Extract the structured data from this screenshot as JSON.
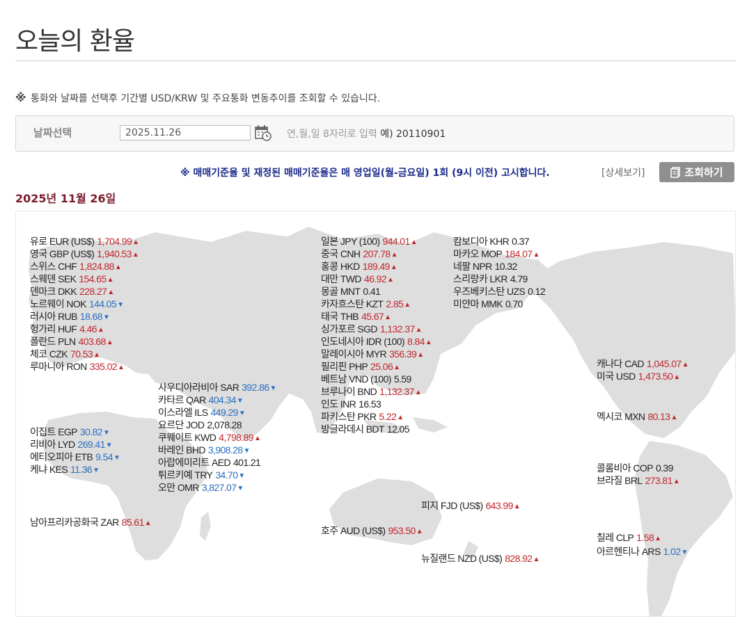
{
  "page": {
    "title": "오늘의 환율",
    "notice_mark": "※",
    "notice": "통화와 날짜를 선택후 기간별 USD/KRW 및 주요통화 변동추이를 조회할 수 있습니다.",
    "date_label": "날짜선택",
    "date_value": "2025.11.26",
    "date_hint": "연,월,일 8자리로 입력",
    "date_example": "예) 20110901",
    "announcement": "※ 매매기준율 및 재정된 매매기준율은 매 영업일(월-금요일) 1회 (9시 이전) 고시합니다.",
    "detail_link": "[상세보기]",
    "query_button": "조회하기",
    "heading_date": "2025년 11월 26일"
  },
  "colors": {
    "up": "#c0272d",
    "down": "#2a6fbf",
    "heading": "#7a1a2a",
    "announce": "#1a2a8a"
  },
  "icons": [
    "calendar-icon",
    "document-icon",
    "up-arrow-icon",
    "down-arrow-icon"
  ],
  "rates": [
    {
      "name": "유로 EUR (US$)",
      "value": "1,704.99",
      "dir": "up"
    },
    {
      "name": "영국 GBP (US$)",
      "value": "1,940.53",
      "dir": "up"
    },
    {
      "name": "스위스 CHF",
      "value": "1,824.88",
      "dir": "up"
    },
    {
      "name": "스웨덴 SEK",
      "value": "154.65",
      "dir": "up"
    },
    {
      "name": "덴마크 DKK",
      "value": "228.27",
      "dir": "up"
    },
    {
      "name": "노르웨이 NOK",
      "value": "144.05",
      "dir": "down"
    },
    {
      "name": "러시아 RUB",
      "value": "18.68",
      "dir": "down"
    },
    {
      "name": "헝가리 HUF",
      "value": "4.46",
      "dir": "up"
    },
    {
      "name": "폴란드 PLN",
      "value": "403.68",
      "dir": "up"
    },
    {
      "name": "체코 CZK",
      "value": "70.53",
      "dir": "up"
    },
    {
      "name": "루마니아 RON",
      "value": "335.02",
      "dir": "up"
    },
    {
      "name": "사우디아라비아 SAR",
      "value": "392.86",
      "dir": "down"
    },
    {
      "name": "카타르 QAR",
      "value": "404.34",
      "dir": "down"
    },
    {
      "name": "이스라엘 ILS",
      "value": "449.29",
      "dir": "down"
    },
    {
      "name": "요르단 JOD",
      "value": "2,078.28",
      "dir": "none"
    },
    {
      "name": "쿠웨이트 KWD",
      "value": "4,798.89",
      "dir": "up"
    },
    {
      "name": "바레인 BHD",
      "value": "3,908.28",
      "dir": "down"
    },
    {
      "name": "아랍에미리트 AED",
      "value": "401.21",
      "dir": "none"
    },
    {
      "name": "튀르키예 TRY",
      "value": "34.70",
      "dir": "down"
    },
    {
      "name": "오만 OMR",
      "value": "3,827.07",
      "dir": "down"
    },
    {
      "name": "이집트 EGP",
      "value": "30.82",
      "dir": "down"
    },
    {
      "name": "리비아 LYD",
      "value": "269.41",
      "dir": "down"
    },
    {
      "name": "에티오피아 ETB",
      "value": "9.54",
      "dir": "down"
    },
    {
      "name": "케냐 KES",
      "value": "11.36",
      "dir": "down"
    },
    {
      "name": "남아프리카공화국 ZAR",
      "value": "85.61",
      "dir": "up"
    },
    {
      "name": "일본 JPY (100)",
      "value": "944.01",
      "dir": "up"
    },
    {
      "name": "중국 CNH",
      "value": "207.78",
      "dir": "up"
    },
    {
      "name": "홍콩 HKD",
      "value": "189.49",
      "dir": "up"
    },
    {
      "name": "대만 TWD",
      "value": "46.92",
      "dir": "up"
    },
    {
      "name": "몽골 MNT",
      "value": "0.41",
      "dir": "none"
    },
    {
      "name": "카자흐스탄 KZT",
      "value": "2.85",
      "dir": "up"
    },
    {
      "name": "태국 THB",
      "value": "45.67",
      "dir": "up"
    },
    {
      "name": "싱가포르 SGD",
      "value": "1,132.37",
      "dir": "up"
    },
    {
      "name": "인도네시아 IDR (100)",
      "value": "8.84",
      "dir": "up"
    },
    {
      "name": "말레이시아 MYR",
      "value": "356.39",
      "dir": "up"
    },
    {
      "name": "필리핀 PHP",
      "value": "25.06",
      "dir": "up"
    },
    {
      "name": "베트남 VND (100)",
      "value": "5.59",
      "dir": "none"
    },
    {
      "name": "브루나이 BND",
      "value": "1,132.37",
      "dir": "up"
    },
    {
      "name": "인도 INR",
      "value": "16.53",
      "dir": "none"
    },
    {
      "name": "파키스탄 PKR",
      "value": "5.22",
      "dir": "up"
    },
    {
      "name": "방글라데시 BDT",
      "value": "12.05",
      "dir": "none"
    },
    {
      "name": "캄보디아 KHR",
      "value": "0.37",
      "dir": "none"
    },
    {
      "name": "마카오 MOP",
      "value": "184.07",
      "dir": "up"
    },
    {
      "name": "네팔 NPR",
      "value": "10.32",
      "dir": "none"
    },
    {
      "name": "스리랑카 LKR",
      "value": "4.79",
      "dir": "none"
    },
    {
      "name": "우즈베키스탄 UZS",
      "value": "0.12",
      "dir": "none"
    },
    {
      "name": "미얀마 MMK",
      "value": "0.70",
      "dir": "none"
    },
    {
      "name": "피지 FJD (US$)",
      "value": "643.99",
      "dir": "up"
    },
    {
      "name": "호주 AUD (US$)",
      "value": "953.50",
      "dir": "up"
    },
    {
      "name": "뉴질랜드 NZD (US$)",
      "value": "828.92",
      "dir": "up"
    },
    {
      "name": "캐나다 CAD",
      "value": "1,045.07",
      "dir": "up"
    },
    {
      "name": "미국 USD",
      "value": "1,473.50",
      "dir": "up"
    },
    {
      "name": "멕시코 MXN",
      "value": "80.13",
      "dir": "up"
    },
    {
      "name": "콜롬비아 COP",
      "value": "0.39",
      "dir": "none"
    },
    {
      "name": "브라질 BRL",
      "value": "273.81",
      "dir": "up"
    },
    {
      "name": "칠레 CLP",
      "value": "1.58",
      "dir": "up"
    },
    {
      "name": "아르헨티나 ARS",
      "value": "1.02",
      "dir": "down"
    }
  ]
}
